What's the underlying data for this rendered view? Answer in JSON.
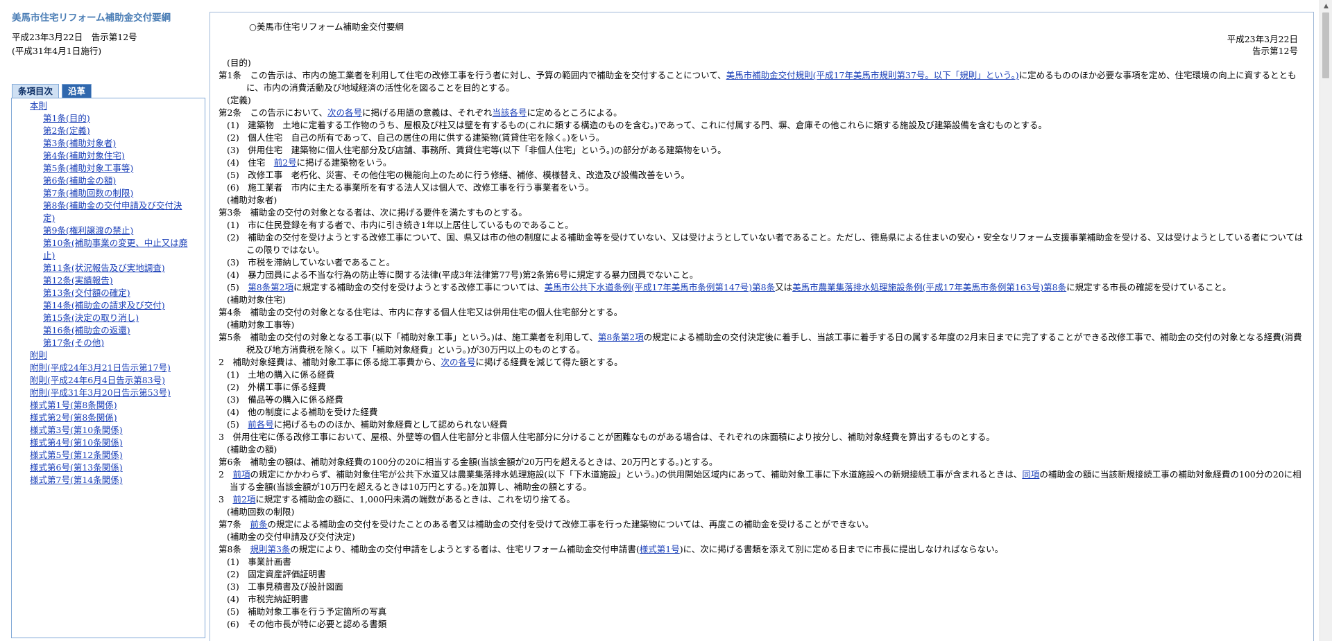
{
  "sidebar": {
    "title": "美馬市住宅リフォーム補助金交付要綱",
    "date_line": "平成23年3月22日　告示第12号",
    "effective": "(平成31年4月1日施行)",
    "tabs": [
      "条項目次",
      "沿革"
    ],
    "toc": [
      {
        "label": "本則",
        "level": 1
      },
      {
        "label": "第1条(目的)",
        "level": 2
      },
      {
        "label": "第2条(定義)",
        "level": 2
      },
      {
        "label": "第3条(補助対象者)",
        "level": 2
      },
      {
        "label": "第4条(補助対象住宅)",
        "level": 2
      },
      {
        "label": "第5条(補助対象工事等)",
        "level": 2
      },
      {
        "label": "第6条(補助金の額)",
        "level": 2
      },
      {
        "label": "第7条(補助回数の制限)",
        "level": 2
      },
      {
        "label": "第8条(補助金の交付申請及び交付決",
        "level": 2
      },
      {
        "label": "定)",
        "level": 2
      },
      {
        "label": "第9条(権利譲渡の禁止)",
        "level": 2
      },
      {
        "label": "第10条(補助事業の変更、中止又は廃",
        "level": 2
      },
      {
        "label": "止)",
        "level": 2
      },
      {
        "label": "第11条(状況報告及び実地調査)",
        "level": 2
      },
      {
        "label": "第12条(実績報告)",
        "level": 2
      },
      {
        "label": "第13条(交付額の確定)",
        "level": 2
      },
      {
        "label": "第14条(補助金の請求及び交付)",
        "level": 2
      },
      {
        "label": "第15条(決定の取り消し)",
        "level": 2
      },
      {
        "label": "第16条(補助金の返還)",
        "level": 2
      },
      {
        "label": "第17条(その他)",
        "level": 2
      },
      {
        "label": "附則",
        "level": 1
      },
      {
        "label": "附則(平成24年3月21日告示第17号)",
        "level": 1
      },
      {
        "label": "附則(平成24年6月4日告示第83号)",
        "level": 1
      },
      {
        "label": "附則(平成31年3月20日告示第53号)",
        "level": 1
      },
      {
        "label": "様式第1号(第8条関係)",
        "level": 1
      },
      {
        "label": "様式第2号(第8条関係)",
        "level": 1
      },
      {
        "label": "様式第3号(第10条関係)",
        "level": 1
      },
      {
        "label": "様式第4号(第10条関係)",
        "level": 1
      },
      {
        "label": "様式第5号(第12条関係)",
        "level": 1
      },
      {
        "label": "様式第6号(第13条関係)",
        "level": 1
      },
      {
        "label": "様式第7号(第14条関係)",
        "level": 1
      }
    ]
  },
  "doc": {
    "title": "○美馬市住宅リフォーム補助金交付要綱",
    "date": "平成23年3月22日",
    "notice": "告示第12号",
    "blocks": [
      {
        "t": "cap",
        "s": [
          "(目的)"
        ]
      },
      {
        "t": "art",
        "s": [
          "第1条　この告示は、市内の施工業者を利用して住宅の改修工事を行う者に対し、予算の範囲内で補助金を交付することについて、",
          {
            "a": "美馬市補助金交付規則(平成17年美馬市規則第37号。以下「規則」という。)"
          },
          "に定めるもののほか必要な事項を定め、住宅環境の向上に資するとともに、市内の消費活動及び地域経済の活性化を図ることを目的とする。"
        ]
      },
      {
        "t": "cap",
        "s": [
          "(定義)"
        ]
      },
      {
        "t": "art",
        "s": [
          "第2条　この告示において、",
          {
            "a": "次の各号"
          },
          "に掲げる用語の意義は、それぞれ",
          {
            "a": "当該各号"
          },
          "に定めるところによる。"
        ]
      },
      {
        "t": "item",
        "s": [
          "(1)　建築物　土地に定着する工作物のうち、屋根及び柱又は壁を有するもの(これに類する構造のものを含む。)であって、これに付属する門、塀、倉庫その他これらに類する施設及び建築設備を含むものとする。"
        ]
      },
      {
        "t": "item",
        "s": [
          "(2)　個人住宅　自己の所有であって、自己の居住の用に供する建築物(賃貸住宅を除く。)をいう。"
        ]
      },
      {
        "t": "item",
        "s": [
          "(3)　併用住宅　建築物に個人住宅部分及び店舗、事務所、賃貸住宅等(以下「非個人住宅」という。)の部分がある建築物をいう。"
        ]
      },
      {
        "t": "item",
        "s": [
          "(4)　住宅　",
          {
            "a": "前2号"
          },
          "に掲げる建築物をいう。"
        ]
      },
      {
        "t": "item",
        "s": [
          "(5)　改修工事　老朽化、災害、その他住宅の機能向上のために行う修繕、補修、模様替え、改造及び設備改善をいう。"
        ]
      },
      {
        "t": "item",
        "s": [
          "(6)　施工業者　市内に主たる事業所を有する法人又は個人で、改修工事を行う事業者をいう。"
        ]
      },
      {
        "t": "cap",
        "s": [
          "(補助対象者)"
        ]
      },
      {
        "t": "art",
        "s": [
          "第3条　補助金の交付の対象となる者は、次に掲げる要件を満たすものとする。"
        ]
      },
      {
        "t": "item",
        "s": [
          "(1)　市に住民登録を有する者で、市内に引き続き1年以上居住しているものであること。"
        ]
      },
      {
        "t": "item",
        "s": [
          "(2)　補助金の交付を受けようとする改修工事について、国、県又は市の他の制度による補助金等を受けていない、又は受けようとしていない者であること。ただし、徳島県による住まいの安心・安全なリフォーム支援事業補助金を受ける、又は受けようとしている者についてはこの限りではない。"
        ]
      },
      {
        "t": "item",
        "s": [
          "(3)　市税を滞納していない者であること。"
        ]
      },
      {
        "t": "item",
        "s": [
          "(4)　暴力団員による不当な行為の防止等に関する法律(平成3年法律第77号)第2条第6号に規定する暴力団員でないこと。"
        ]
      },
      {
        "t": "item",
        "s": [
          "(5)　",
          {
            "a": "第8条第2項"
          },
          "に規定する補助金の交付を受けようとする改修工事については、",
          {
            "a": "美馬市公共下水道条例(平成17年美馬市条例第147号)第8条"
          },
          "又は",
          {
            "a": "美馬市農業集落排水処理施設条例(平成17年美馬市条例第163号)第8条"
          },
          "に規定する市長の確認を受けていること。"
        ]
      },
      {
        "t": "cap",
        "s": [
          "(補助対象住宅)"
        ]
      },
      {
        "t": "art",
        "s": [
          "第4条　補助金の交付の対象となる住宅は、市内に存する個人住宅又は併用住宅の個人住宅部分とする。"
        ]
      },
      {
        "t": "cap",
        "s": [
          "(補助対象工事等)"
        ]
      },
      {
        "t": "art",
        "s": [
          "第5条　補助金の交付の対象となる工事(以下「補助対象工事」という。)は、施工業者を利用して、",
          {
            "a": "第8条第2項"
          },
          "の規定による補助金の交付決定後に着手し、当該工事に着手する日の属する年度の2月末日までに完了することができる改修工事で、補助金の交付の対象となる経費(消費税及び地方消費税を除く。以下「補助対象経費」という。)が30万円以上のものとする。"
        ]
      },
      {
        "t": "para",
        "s": [
          "2　補助対象経費は、補助対象工事に係る総工事費から、",
          {
            "a": "次の各号"
          },
          "に掲げる経費を減じて得た額とする。"
        ]
      },
      {
        "t": "item",
        "s": [
          "(1)　土地の購入に係る経費"
        ]
      },
      {
        "t": "item",
        "s": [
          "(2)　外構工事に係る経費"
        ]
      },
      {
        "t": "item",
        "s": [
          "(3)　備品等の購入に係る経費"
        ]
      },
      {
        "t": "item",
        "s": [
          "(4)　他の制度による補助を受けた経費"
        ]
      },
      {
        "t": "item",
        "s": [
          "(5)　",
          {
            "a": "前各号"
          },
          "に掲げるもののほか、補助対象経費として認められない経費"
        ]
      },
      {
        "t": "para",
        "s": [
          "3　併用住宅に係る改修工事において、屋根、外壁等の個人住宅部分と非個人住宅部分に分けることが困難なものがある場合は、それぞれの床面積により按分し、補助対象経費を算出するものとする。"
        ]
      },
      {
        "t": "cap",
        "s": [
          "(補助金の額)"
        ]
      },
      {
        "t": "art",
        "s": [
          "第6条　補助金の額は、補助対象経費の100分の20に相当する金額(当該金額が20万円を超えるときは、20万円とする。)とする。"
        ]
      },
      {
        "t": "para",
        "s": [
          "2　",
          {
            "a": "前項"
          },
          "の規定にかかわらず、補助対象住宅が公共下水道又は農業集落排水処理施設(以下「下水道施設」という。)の供用開始区域内にあって、補助対象工事に下水道施設への新規接続工事が含まれるときは、",
          {
            "a": "同項"
          },
          "の補助金の額に当該新規接続工事の補助対象経費の100分の20に相当する金額(当該金額が10万円を超えるときは10万円とする。)を加算し、補助金の額とする。"
        ]
      },
      {
        "t": "para",
        "s": [
          "3　",
          {
            "a": "前2項"
          },
          "に規定する補助金の額に、1,000円未満の端数があるときは、これを切り捨てる。"
        ]
      },
      {
        "t": "cap",
        "s": [
          "(補助回数の制限)"
        ]
      },
      {
        "t": "art",
        "s": [
          "第7条　",
          {
            "a": "前条"
          },
          "の規定による補助金の交付を受けたことのある者又は補助金の交付を受けて改修工事を行った建築物については、再度この補助金を受けることができない。"
        ]
      },
      {
        "t": "cap",
        "s": [
          "(補助金の交付申請及び交付決定)"
        ]
      },
      {
        "t": "art",
        "s": [
          "第8条　",
          {
            "a": "規則第3条"
          },
          "の規定により、補助金の交付申請をしようとする者は、住宅リフォーム補助金交付申請書(",
          {
            "a": "様式第1号"
          },
          ")に、次に掲げる書類を添えて別に定める日までに市長に提出しなければならない。"
        ]
      },
      {
        "t": "item",
        "s": [
          "(1)　事業計画書"
        ]
      },
      {
        "t": "item",
        "s": [
          "(2)　固定資産評価証明書"
        ]
      },
      {
        "t": "item",
        "s": [
          "(3)　工事見積書及び設計図面"
        ]
      },
      {
        "t": "item",
        "s": [
          "(4)　市税完納証明書"
        ]
      },
      {
        "t": "item",
        "s": [
          "(5)　補助対象工事を行う予定箇所の写真"
        ]
      },
      {
        "t": "item",
        "s": [
          "(6)　その他市長が特に必要と認める書類"
        ]
      }
    ]
  }
}
